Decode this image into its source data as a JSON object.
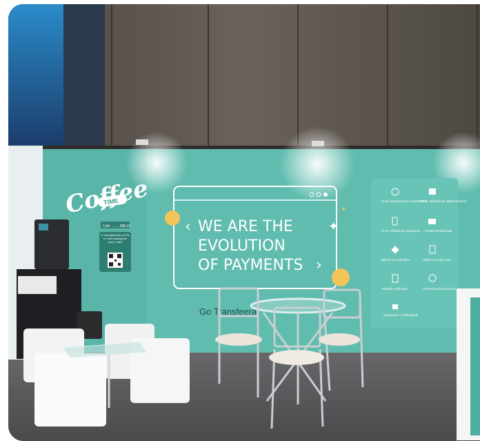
{
  "booth": {
    "coffee_sign": "Coffee",
    "coffee_sign_sub": "TIME",
    "qr_header": "Café ........ R$0,01",
    "qr_caption": "O carregamento do Pix é o seu passaporte para o café!",
    "headline_lines": [
      "WE ARE THE",
      "EVOLUTION",
      "OF PAYMENTS"
    ],
    "brand_text": "Go Transfeera",
    "features": [
      {
        "icon": "dollar-coin-icon",
        "label": "API de pagamentos e recebimentos"
      },
      {
        "icon": "bank-icon",
        "label": "API de validação de dados bancários"
      },
      {
        "icon": "phone-icon",
        "label": "API de iniciador de pagamento"
      },
      {
        "icon": "camera-icon",
        "label": "Contas transacionais"
      },
      {
        "icon": "pix-icon",
        "label": "Split de Pix automático"
      },
      {
        "icon": "document-icon",
        "label": "Boleto com QR Code"
      },
      {
        "icon": "report-icon",
        "label": "Relatório Antifraude"
      },
      {
        "icon": "globe-icon",
        "label": "Remessas internacionais"
      },
      {
        "icon": "lock-icon",
        "label": "Segurança e conformidade"
      }
    ]
  },
  "colors": {
    "wall_teal": "#5fbcae",
    "panel_teal": "#68c4b6",
    "curtain": "#5e5650",
    "floor": "#58575a"
  }
}
